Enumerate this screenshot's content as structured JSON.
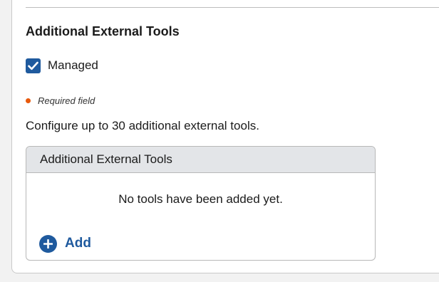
{
  "section": {
    "title": "Additional External Tools"
  },
  "managed": {
    "label": "Managed",
    "checked": true
  },
  "required": {
    "label": "Required field",
    "dot_color": "#e8590c"
  },
  "description": "Configure up to 30 additional external tools.",
  "tools_panel": {
    "header": "Additional External Tools",
    "empty_message": "No tools have been added yet.",
    "add_label": "Add"
  },
  "colors": {
    "accent": "#1f5a9e",
    "panel_header_bg": "#e3e5e8"
  }
}
